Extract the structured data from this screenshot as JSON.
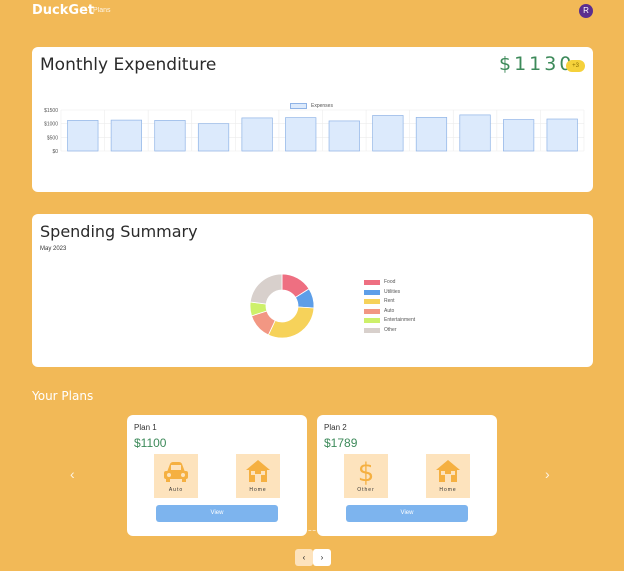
{
  "app": {
    "brand": "DuckGet",
    "nav_plans": "Plans",
    "avatar_initial": "R"
  },
  "expenditure": {
    "title": "Monthly Expenditure",
    "total": "$1130",
    "delta": "+3"
  },
  "summary": {
    "title": "Spending Summary",
    "subtitle": "May 2023"
  },
  "plans_section": {
    "title": "Your Plans"
  },
  "plans": [
    {
      "name": "Plan 1",
      "amount": "$1100",
      "tiles": [
        {
          "label": "Auto",
          "icon": "car-icon"
        },
        {
          "label": "Home",
          "icon": "house-icon"
        }
      ],
      "view_label": "View"
    },
    {
      "name": "Plan 2",
      "amount": "$1789",
      "tiles": [
        {
          "label": "Other",
          "icon": "dollar-icon"
        },
        {
          "label": "Home",
          "icon": "house-icon"
        }
      ],
      "view_label": "View"
    }
  ],
  "carousel": {
    "prev_glyph": "‹",
    "next_glyph": "›"
  },
  "pager": {
    "prev_glyph": "‹",
    "next_glyph": "›"
  },
  "colors": {
    "background": "#f2b957",
    "accent_green": "#3d8a5a",
    "bar_fill": "#dceafc",
    "bar_stroke": "#8fb3e6",
    "button": "#7db4ee",
    "tile": "#fde3bd",
    "avatar": "#5b2e8f"
  },
  "chart_data": [
    {
      "type": "bar",
      "legend": [
        "Expenses"
      ],
      "categories": [
        "",
        "",
        "",
        "",
        "",
        "",
        "",
        "",
        "",
        "",
        "",
        ""
      ],
      "series": [
        {
          "name": "Expenses",
          "values": [
            1120,
            1130,
            1120,
            1000,
            1210,
            1220,
            1100,
            1300,
            1230,
            1320,
            1150,
            1170
          ]
        }
      ],
      "y_ticks": [
        "$0",
        "$500",
        "$1000",
        "$1500"
      ],
      "ylim": [
        0,
        1500
      ],
      "grid": true,
      "legend_position": "top"
    },
    {
      "type": "pie",
      "donut": true,
      "labels": [
        "Food",
        "Utilities",
        "Rent",
        "Auto",
        "Entertainment",
        "Other"
      ],
      "values": [
        16,
        10,
        31,
        13,
        7,
        23
      ],
      "colors": [
        "#ee6f81",
        "#5d9ee8",
        "#f6d25a",
        "#f29783",
        "#cdf06a",
        "#d8d0cc"
      ],
      "legend_position": "right"
    }
  ]
}
